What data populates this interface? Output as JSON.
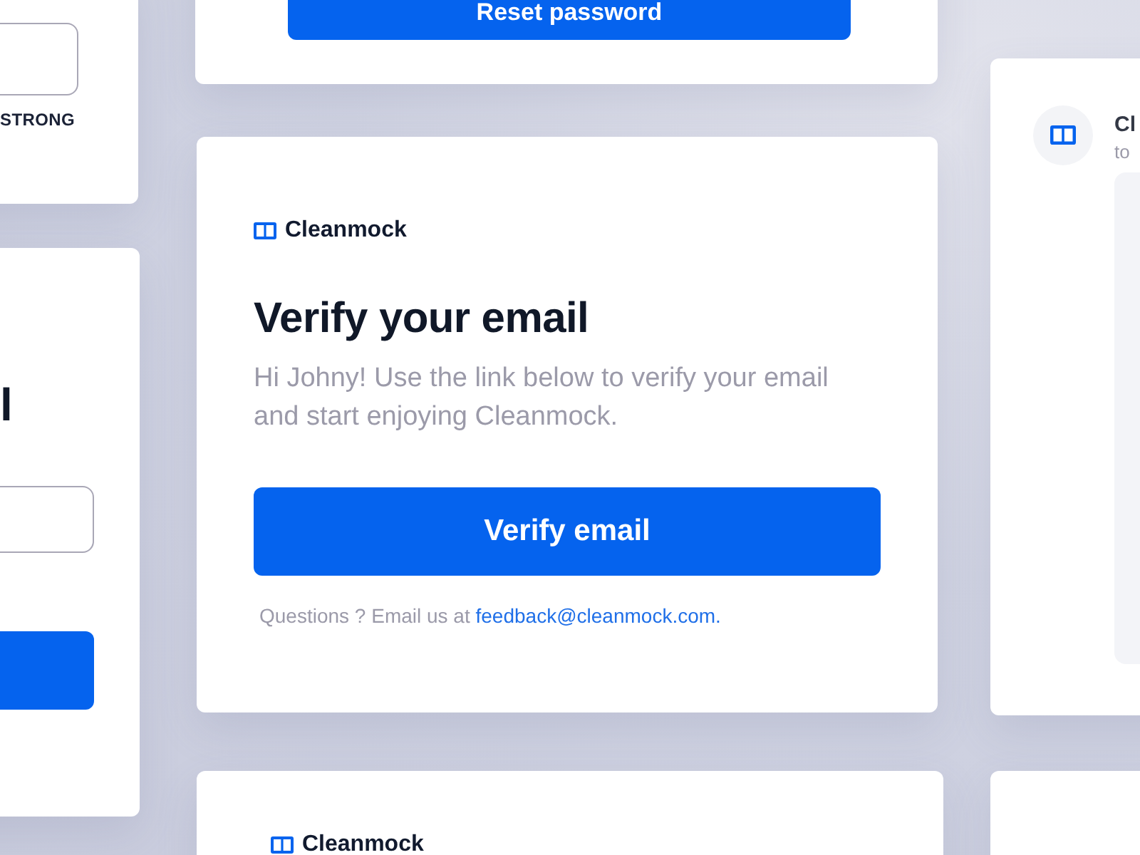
{
  "password_card": {
    "strength_label": "STRONG"
  },
  "reset_card": {
    "button": "Reset password"
  },
  "verify_card": {
    "brand": "Cleanmock",
    "title": "Verify your email",
    "message": "Hi Johny! Use the link below to verify your email and start enjoying Cleanmock.",
    "button": "Verify email",
    "footer": "Questions ? Email us at",
    "link": "feedback@cleanmock.com."
  },
  "login_card": {
    "title": "l"
  },
  "message_card": {
    "sender": "Cl",
    "preview": "to"
  },
  "bottom_card": {
    "brand": "Cleanmock"
  }
}
